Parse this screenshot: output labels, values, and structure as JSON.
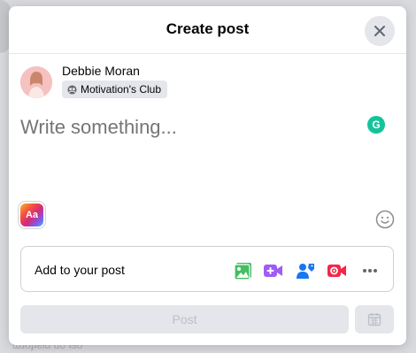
{
  "dialog": {
    "title": "Create post",
    "close_icon": "close-icon"
  },
  "user": {
    "name": "Debbie Moran",
    "audience_label": "Motivation's Club",
    "audience_icon": "group-icon"
  },
  "composer": {
    "placeholder": "Write something..."
  },
  "tools": {
    "background_style_label": "Aa",
    "grammarly_label": "G",
    "emoji_icon": "emoji-icon"
  },
  "add_to_post": {
    "label": "Add to your post",
    "items": [
      {
        "icon": "photo-video-icon",
        "color": "#45bd62"
      },
      {
        "icon": "video-camera-icon",
        "color": "#a05cf2"
      },
      {
        "icon": "tag-people-icon",
        "color": "#1877f2"
      },
      {
        "icon": "live-video-icon",
        "color": "#f02849"
      },
      {
        "icon": "more-icon",
        "color": "#65676b"
      }
    ]
  },
  "footer": {
    "post_label": "Post",
    "schedule_icon": "calendar-icon"
  },
  "background": {
    "peek_text": "ɯɹoɟʇɐld uo ʇso"
  }
}
